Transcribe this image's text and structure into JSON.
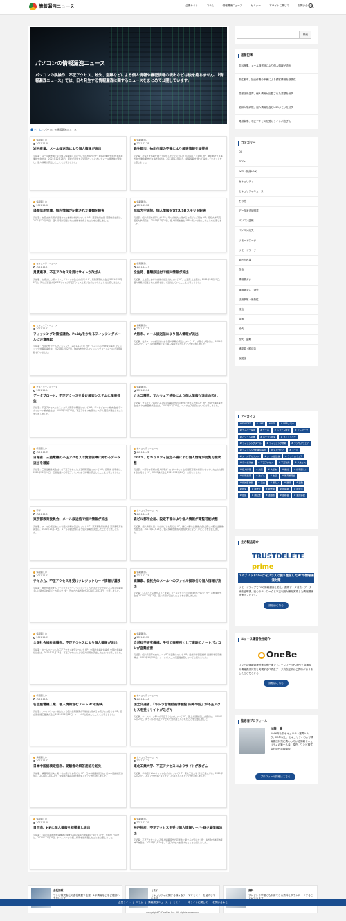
{
  "site": {
    "name": "情報漏洩ニュース"
  },
  "nav": {
    "items": [
      "企業サイト",
      "コラム",
      "情報漏洩ニュース",
      "セミナー",
      "本サイトに関して",
      "お問い合わせ"
    ]
  },
  "hero": {
    "title": "パソコンの情報漏洩ニュース",
    "description": "パソコンの誤操作、不正アクセス、紛失、盗難などによる個人情報や機密情報の流出などは後を絶ちません。『情報漏洩ニュース』では、日々発生する情報漏洩に関するニュースをまとめて公開しています。"
  },
  "breadcrumb": {
    "home": "ホーム",
    "current": "パソコンの情報漏洩ニュース"
  },
  "cards": [
    {
      "category": "情報漏えい",
      "date": "2021.12.28",
      "title": "岩谷産業、メール誤送信により個人情報が流出",
      "excerpt": "元記事：メール誤送信により個人情報漏えいについてのお詫び HP：岩谷産業株式会社 岩谷産業株式会社は、2021年12月28日、同社が運営するWEBサイトにおいてメール誤送信が発生し、個人情報が流出したことを公表しました。"
    },
    {
      "category": "情報漏えい",
      "date": "2021.12.28",
      "title": "駒生都市、抽出作業の不備により顧客情報を誤提供",
      "excerpt": "元記事：お客さま情報を誤って提供したことについてのお詫びとご説明 HP：駒生都市ガス株式会社 駒生都市ガス株式会社は、2021年12月28日、顧客情報を誤って提供していたことを公表しました。"
    },
    {
      "category": "情報漏えい",
      "date": "2021.12.28",
      "title": "藻都信用金庫、個人情報が記載された書類を紛失",
      "excerpt": "元記事：お客さま情報が記載された書類の紛失について HP：藻都信用金庫 藻都信用金庫は、2021年12月28日、個人情報が記載された書類を紛失したことを公表しました。"
    },
    {
      "category": "情報漏えい",
      "date": "2021.12.28",
      "title": "昭和大学病院、個人情報を含むUSBメモリを紛失",
      "excerpt": "元記事：個人情報を保存したUSBメモリの紛失に関するお詫びとご報告 HP：昭和大学病院 昭和大学病院は、2021年12月28日、個人情報を含むUSBメモリを紛失したことを公表しました。"
    },
    {
      "category": "セキュリティニュース",
      "date": "2021.12.27",
      "title": "見積東亨、不正アクセスを受けサイトが改ざん",
      "excerpt": "元記事：お詫びとお願い（ウェブサイトの改ざんの件）HP：見積東亨株式会社 2021年12月27日、同社が運営するWEBサイトが不正アクセスを受け改ざんされたことを公表しました。"
    },
    {
      "category": "情報漏えい",
      "date": "2021.12.27",
      "title": "全生苑、書類誤送付で個人情報が流出",
      "excerpt": "元記事：全生苑における書類の誤送付について HP：全生苑 全生苑は、2021年12月27日、個人情報が記載された書類を誤って送付していたことを公表しました。"
    },
    {
      "category": "セキュリティニュース",
      "date": "2021.12.27",
      "title": "フィッシング対策協議会、Paidyをかたるフィッシングメールに注意喚起",
      "excerpt": "元記事：Paidy をかたるフィッシング（2021/12/27）HP：フィッシング対策協議会 フィッシング対策協議会は、2021年12月27日、Paidyをかたるフィッシングメールについて注意喚起を行いました。"
    },
    {
      "category": "情報漏えい",
      "date": "2021.12.27",
      "title": "大阪市、メール誤送信により個人情報が流出",
      "excerpt": "元記事：電子メールの誤送信による個人情報の流出について HP：大阪市 大阪市は、2021年12月27日、メールの誤送信により個人情報が流出したことを公表しました。"
    },
    {
      "category": "セキュリティニュース",
      "date": "2021.12.24",
      "title": "データブロード、不正アクセスを受け顧客システムに障害発生",
      "excerpt": "元記事：不正アクセスによるシステム障害の発生について HP：データブロード株式会社 データブロード株式会社は、2021年12月24日、不正アクセスを受けシステム障害が発生したことを公表しました。"
    },
    {
      "category": "情報漏えい",
      "date": "2021.12.24",
      "title": "カネコ種苗、マルウェア感染により個人情報が流出の恐れ",
      "excerpt": "元記事：マルウェア感染による個人情報流出の可能性に関するお知らせ HP：カネコ種苗株式会社 カネコ種苗株式会社は、2021年12月24日、マルウェア感染について公表しました。"
    },
    {
      "category": "情報漏えい",
      "date": "2021.12.24",
      "title": "日報省、三菱電機の不正アクセスで資金保障に関わるデータ流出を確認",
      "excerpt": "元記事：三菱電機株式会社への不正アクセスによる情報流出について HP：日報省 日報省は、2021年12月24日、三菱電機への不正アクセスにより情報が流出したことを公表しました。"
    },
    {
      "category": "セキュリティニュース",
      "date": "2021.12.24",
      "title": "OCCS、セキュリティ設定不備により個人情報が閲覧可能状態",
      "excerpt": "元記事：一部のお客様の個人情報がインターネット上で閲覧可能な状態になっていたことに関するお知らせ HP：OCCS株式会社 2021年12月24日、公表しました。"
    },
    {
      "category": "不祥",
      "date": "2021.12.23",
      "title": "東京都教育委員会、メール誤送信で個人情報が流出",
      "excerpt": "元記事：メールの誤送信による個人情報の流出について HP：東京都教育委員会 東京都教育委員会は、2021年12月23日、メールの誤送信により個人情報が流出したことを公表しました。"
    },
    {
      "category": "セキュリティニュース",
      "date": "2021.12.23",
      "title": "森ビル都市企画、設定不備により個人情報が閲覧可能状態",
      "excerpt": "元記事：個人情報に関するお詫びとお知らせ HP：森ビル都市企画株式会社 森ビル都市企画株式会社は、2021年12月23日、個人情報が閲覧可能な状態になっていたことを公表しました。"
    },
    {
      "category": "情報漏えい",
      "date": "2021.12.23",
      "title": "チキカカ、不正アクセスを受けクレジットカード情報が漏洩",
      "excerpt": "元記事：弊社が運営する「チキカカオンラインショップ」への不正アクセスによる個人情報漏えいに関するお詫びとお知らせ HP：チキカカ株式会社 2021年12月23日、公表しました。"
    },
    {
      "category": "情報漏えい",
      "date": "2021.12.23",
      "title": "高輝素、委託先のメールへのファイル誤添付で個人情報が流出",
      "excerpt": "元記事：「ふるさと応援ひょうご大使」メールマガジンへの誤添付について HP：高輝素株式会社 2021年12月23日、個人情報が流出したことを公表しました。"
    },
    {
      "category": "情報漏えい",
      "date": "2021.12.23",
      "title": "全国社会福祉協議会、不正アクセスにより個人情報が流出",
      "excerpt": "元記事：ホームページへの不正アクセス被害について HP：全国社会福祉協議会 全国社会福祉協議会は、2021年12月23日、不正アクセスにより個人情報が流出したことを公表しました。"
    },
    {
      "category": "情報漏えい",
      "date": "2021.12.22",
      "title": "自然科学研究機構、手引で事務所として道跡てノートパソコンが盗難被害",
      "excerpt": "元記事：個人情報等を含むノートPCの盗難について HP：自然科学研究機構 自然科学研究機構は、2021年12月22日、ノートパソコンの盗難被害について公表しました。"
    },
    {
      "category": "情報漏えい",
      "date": "2021.12.22",
      "title": "名古屋電機工業、個人情報含むノートPCを紛失",
      "excerpt": "元記事：ノートパソコン紛失による個人情報漏洩の可能性に関するお詫びとお知らせ HP：名古屋電機工業株式会社 2021年12月22日、ノートPCを紛失したことを公表しました。"
    },
    {
      "category": "セキュリティニュース",
      "date": "2021.12.22",
      "title": "国土交通省、「キトラ古墳壁画体験館 四神の館」が不正アクセスを受けサイトが改ざん",
      "excerpt": "元記事：ホームページ等への不正アクセスについて HP：国土交通省 国土交通省は、2021年12月22日、同サイトが不正アクセスを受け改ざんされたことを公表しました。"
    },
    {
      "category": "情報漏えい",
      "date": "2021.12.22",
      "title": "日本中国語検定協会、受験者の解答用紙を紛失",
      "excerpt": "元記事：解答用紙紛失に関するお詫びとお知らせ HP：日本中国語検定協会 日本中国語検定協会は、2021年12月22日、受験者の解答用紙を紛失したことを公表しました。"
    },
    {
      "category": "セキュリティニュース",
      "date": "2021.12.22",
      "title": "東北工業大学、不正アクセスによりサイトが改ざん",
      "excerpt": "元記事：学科紹介Webサイトの改ざんについて HP：東北工業大学 東北工業大学は、2021年12月22日、不正アクセスによりサイトが改ざんされたことを公表しました。"
    },
    {
      "category": "情報漏えい",
      "date": "2021.12.28",
      "title": "日四市、HPに個人情報を誤掲載し流出",
      "excerpt": "元記事：「固定資産税課税事業者に関する個人情報の誤掲載について」HP：日四市 日四市は、2021年12月28日、ホームページに個人情報を誤掲載したことを公表しました。"
    },
    {
      "category": "情報漏えい",
      "date": "2021.12.20",
      "title": "神戸物産、不正アクセスを受け個人情報サーバ-器ジ業情報流出",
      "excerpt": "元記事：不正アクセスによる個人情報流出の可能性に関するお知らせ HP：株式会社神戸物産 神戸物産は、2021年12月20日、不正アクセスを受けたことを公表しました。"
    }
  ],
  "pagination": {
    "pages": [
      "1",
      "2",
      "3",
      "…",
      "67",
      "»"
    ]
  },
  "sidebar": {
    "search": {
      "placeholder": "",
      "button": "検索"
    },
    "recent": {
      "heading": "最新記事",
      "items": [
        "岩谷産業、メール誤送信により個人情報が流出",
        "駒生都市、抽出作業の不備により顧客情報を誤提供",
        "藻都信用金庫、個人情報が記載された書類を紛失",
        "昭和大学病院、個人情報を含むUSBメモリを紛失",
        "見積東亨、不正アクセスを受けサイトが改ざん"
      ]
    },
    "categories": {
      "heading": "カテゴリー",
      "items": [
        "DX",
        "SDGs",
        "WiFi（無線LAN）",
        "セキュリティ",
        "セキュリティニュース",
        "その他",
        "データ消去証明書",
        "パソコン盗難",
        "パソコン紛失",
        "リモートワーク",
        "リモートワーク",
        "働き方改革",
        "自治",
        "情報漏えい",
        "情報漏えい（海外）",
        "法案事故・最新性",
        "流出",
        "盗難",
        "紛失",
        "紛失　盗難",
        "補助金・助成金",
        "誤送信"
      ]
    },
    "archive": {
      "heading": "アーカイブ",
      "select": "月を選択"
    },
    "tags": {
      "heading": "タグ",
      "items": [
        "EMOTET",
        "LINE",
        "USB",
        "USBメモリ",
        "サイバー保険",
        "サーバ",
        "システム障害",
        "テレワーク",
        "パソコン盗難",
        "パソコン紛失",
        "フィッシング",
        "フィッシングメール",
        "フィッシング詐欺",
        "ランサムウェア",
        "フィッシング対策協議会",
        "マルウェア",
        "メール",
        "メールアカウント",
        "メール誤送信",
        "ランサムウェア",
        "データ消去",
        "不正アクセス",
        "不正利用",
        "人為ミス",
        "個人情報",
        "大阪",
        "大阪市",
        "委託",
        "情報漏えい",
        "情報漏洩",
        "改ざん",
        "改竄",
        "教育委員会",
        "標的型攻撃",
        "流出",
        "漏えい",
        "漏洩",
        "盗難",
        "紛失",
        "誤送付",
        "誤送信",
        "誤掲載",
        "誤表示",
        "誤配",
        "誤配送",
        "退職者",
        "離職者",
        "漏洩事故"
      ]
    },
    "promo": {
      "heading": "主力製品紹介",
      "logo_a": "TRUSTDELETE",
      "logo_b": "prime",
      "banner": "ハイブリッドワークをプラスで使う進化したPCの情報漏洩対策",
      "text": "リモートワイプでPCの情報漏洩を防止。遠隔データ消去・データ消去証明書。安心のテレワークと不正利用対策を実現した情報漏洩対策ソフトです。",
      "button": "詳細はこちら"
    },
    "company": {
      "heading": "ニュース運営会社紹介",
      "logo": "OneBe",
      "text": "ワンビは情報漏洩対策の専門家です。テレワークPC紛失・盗難時の情報漏洩対策を実現するIT資産データ消去証明にご興味がありましたらこちらから！",
      "button": "詳細はこちら"
    },
    "profile": {
      "heading": "監修者プロフィール",
      "name": "加藤　慶",
      "text": "1996年よりセキュリティ業界へ入り、25年以上、セキュリティおよび情報漏洩対策に携わっている情報セキュリティの第一人者。現在、ワンビ株式会社の代表取締役。",
      "button": "プロフィール詳細はこちら"
    }
  },
  "bottom": [
    {
      "title": "会社情報",
      "text": "ワンビ株式会社の会社概要や企業、1年情報などをご確認いただけます。"
    },
    {
      "title": "セミナー",
      "text": "セキュリティに関する様々なテーマでセミナーを紹介しています。"
    },
    {
      "title": "資料",
      "text": "プレゼンや学習にも利用できる資料をダウンロードすることができます。"
    }
  ],
  "footer": {
    "links": [
      "企業サイト",
      "コラム",
      "情報漏洩ニュース",
      "セミナー",
      "本サイトに関して",
      "お問い合わせ"
    ],
    "copyright": "copyright© OneBe, Inc. All rights reserved."
  }
}
